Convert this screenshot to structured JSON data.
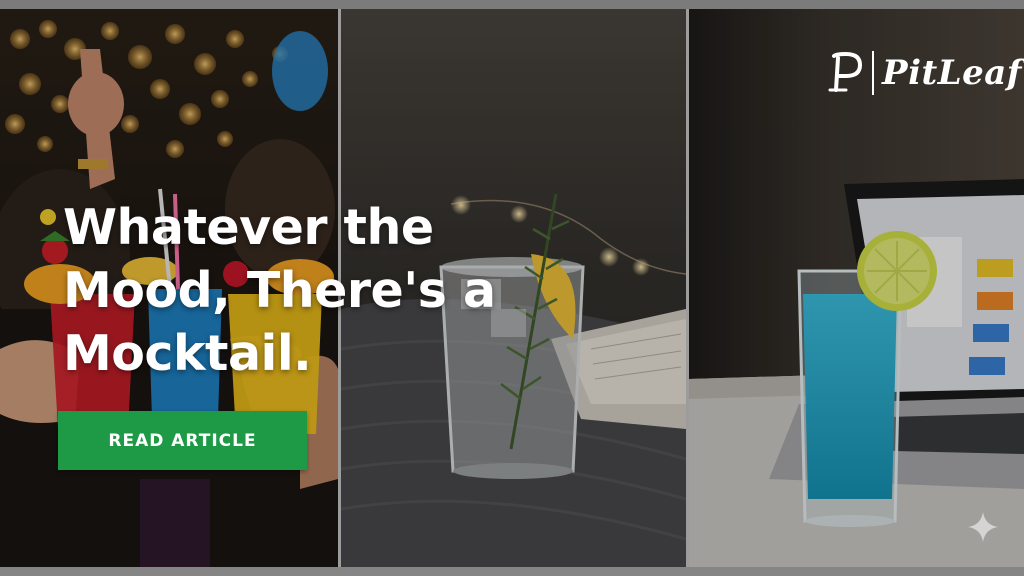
{
  "hero": {
    "headline": "Whatever the Mood, There's a Mocktail.",
    "cta_label": "READ ARTICLE"
  },
  "brand": {
    "logo_text": "PitLeaf",
    "logo_mark": "P"
  },
  "panels": [
    {
      "name": "party-cocktails-photo"
    },
    {
      "name": "rosemary-lemon-drink-photo"
    },
    {
      "name": "blue-drink-laptop-photo"
    }
  ],
  "colors": {
    "cta_background": "#1e9a46",
    "text": "#ffffff"
  },
  "icons": [
    "sparkle-icon",
    "pitleaf-logo"
  ]
}
